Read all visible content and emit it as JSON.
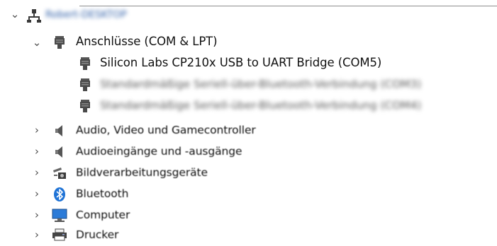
{
  "tree": {
    "root": {
      "label": "Robert-DESKTOP",
      "expanded": true,
      "icon": "computer-network-icon"
    },
    "ports": {
      "label": "Anschlüsse (COM & LPT)",
      "expanded": true,
      "icon": "port-connector-icon",
      "children": [
        {
          "label": "Silicon Labs CP210x USB to UART Bridge (COM5)",
          "icon": "port-connector-icon",
          "blurred": false
        },
        {
          "label": "Standardmäßige Seriell-über-Bluetooth-Verbindung (COM3)",
          "icon": "port-connector-icon",
          "blurred": true
        },
        {
          "label": "Standardmäßige Seriell-über-Bluetooth-Verbindung (COM4)",
          "icon": "port-connector-icon",
          "blurred": true
        }
      ]
    },
    "categories": [
      {
        "label": "Audio, Video und Gamecontroller",
        "icon": "speaker-icon"
      },
      {
        "label": "Audioeingänge und -ausgänge",
        "icon": "speaker-icon"
      },
      {
        "label": "Bildverarbeitungsgeräte",
        "icon": "camera-scanner-icon"
      },
      {
        "label": "Bluetooth",
        "icon": "bluetooth-icon"
      },
      {
        "label": "Computer",
        "icon": "monitor-icon"
      },
      {
        "label": "Drucker",
        "icon": "printer-icon"
      }
    ]
  },
  "glyphs": {
    "expanded": "⌄",
    "collapsed": "›"
  },
  "colors": {
    "bluetooth": "#1f73d6",
    "monitor": "#2b7bd8",
    "tree_line": "#8c8c8c"
  }
}
